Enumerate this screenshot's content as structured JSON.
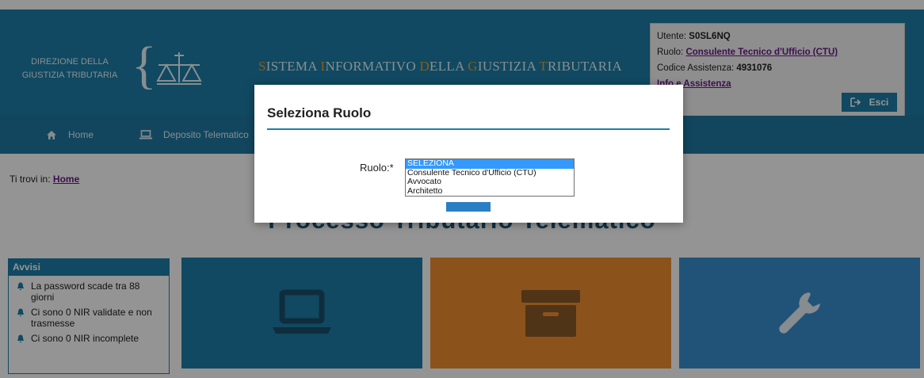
{
  "header": {
    "org_line1": "DIREZIONE DELLA",
    "org_line2": "GIUSTIZIA TRIBUTARIA",
    "system_title": "SISTEMA INFORMATIVO DELLA GIUSTIZIA TRIBUTARIA",
    "logo_icon": "scales-icon",
    "colors": {
      "brand": "#1d7ea8",
      "title_initials": "#f0a020"
    }
  },
  "user": {
    "utente_label": "Utente:",
    "utente_value": "S0SL6NQ",
    "ruolo_label": "Ruolo:",
    "ruolo_value": "Consulente Tecnico d'Ufficio (CTU)",
    "codice_label": "Codice Assistenza:",
    "codice_value": "4931076",
    "info_link": "Info e Assistenza",
    "exit_label": "Esci",
    "exit_icon": "sign-out-icon"
  },
  "nav": {
    "items": [
      {
        "label": "Home",
        "icon": "home-icon"
      },
      {
        "label": "Deposito Telematico",
        "icon": "laptop-icon"
      }
    ]
  },
  "breadcrumb": {
    "prefix": "Ti trovi in:",
    "link": "Home"
  },
  "main": {
    "title": "Processo Tributario Telematico"
  },
  "avvisi": {
    "title": "Avvisi",
    "items": [
      "La password scade tra 88 giorni",
      "Ci sono 0 NIR validate e non trasmesse",
      "Ci sono 0 NIR incomplete"
    ]
  },
  "tiles": [
    {
      "icon": "laptop-icon",
      "color": "#1d7ea8"
    },
    {
      "icon": "archive-box-icon",
      "color": "#f09030"
    },
    {
      "icon": "wrench-icon",
      "color": "#3a8fd0"
    }
  ],
  "modal": {
    "title": "Seleziona Ruolo",
    "field_label": "Ruolo:*",
    "options": [
      "SELEZIONA",
      "Consulente Tecnico d'Ufficio (CTU)",
      "Avvocato",
      "Architetto"
    ],
    "selected_option": "SELEZIONA"
  }
}
